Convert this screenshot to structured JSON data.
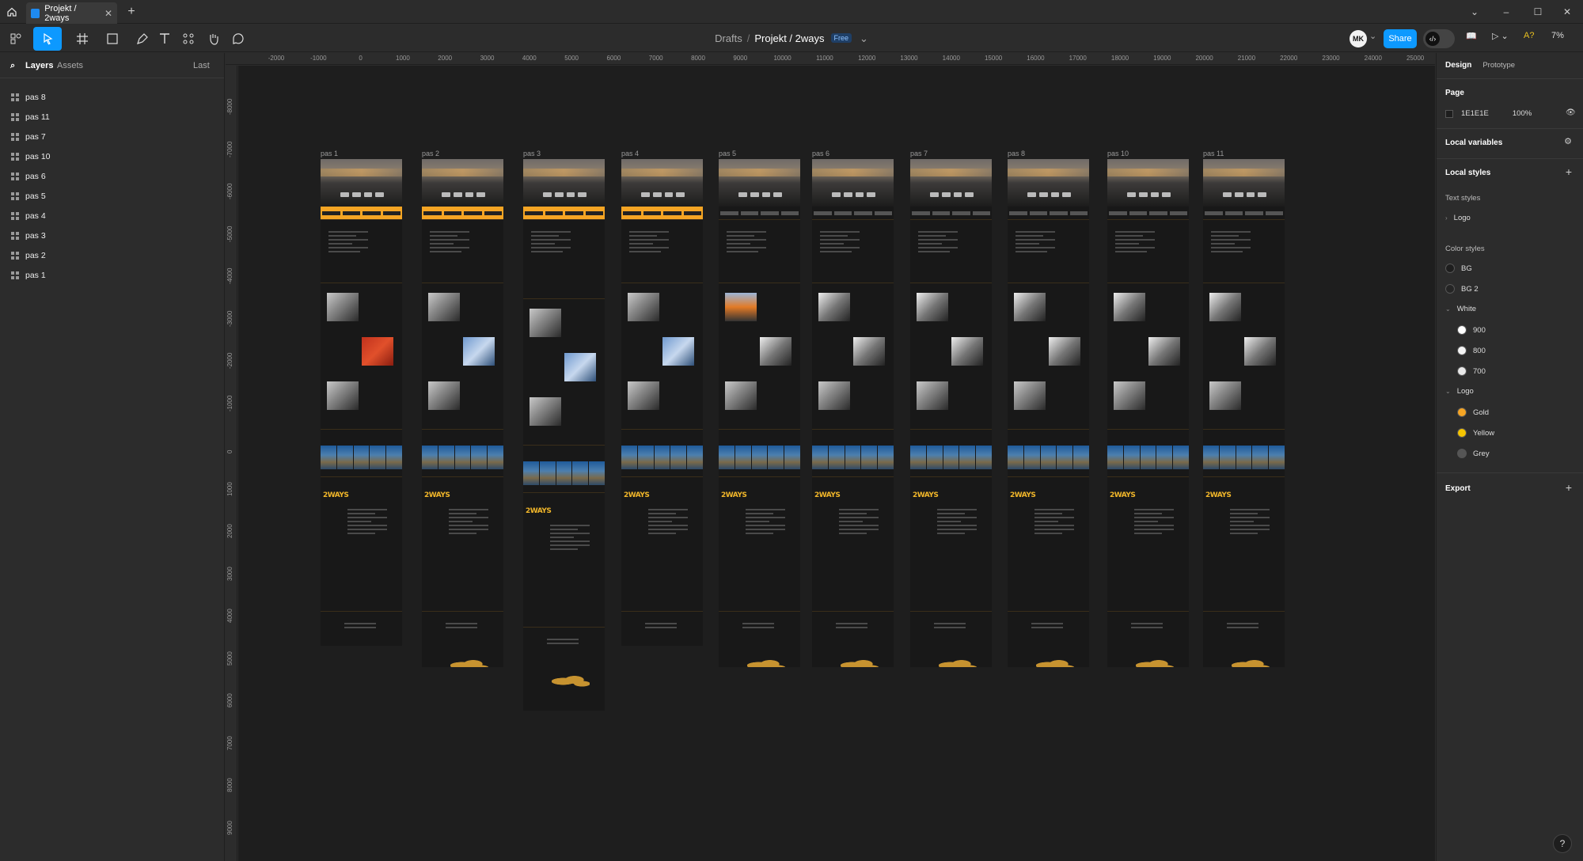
{
  "tabs": [
    {
      "label": "Projekt / 2ways"
    }
  ],
  "toolbar": {
    "breadcrumb_parent": "Drafts",
    "breadcrumb_current": "Projekt / 2ways",
    "plan_badge": "Free",
    "avatar_initials": "MK",
    "share_label": "Share",
    "zoom": "7%",
    "a11y_label": "A?"
  },
  "left_panel": {
    "tab_layers": "Layers",
    "tab_assets": "Assets",
    "sort_label": "Last",
    "layers": [
      "pas 8",
      "pas 11",
      "pas 7",
      "pas 10",
      "pas 6",
      "pas 5",
      "pas 4",
      "pas 3",
      "pas 2",
      "pas 1"
    ]
  },
  "ruler": {
    "top": [
      "-2000",
      "-1000",
      "0",
      "1000",
      "2000",
      "3000",
      "4000",
      "5000",
      "6000",
      "7000",
      "8000",
      "9000",
      "10000",
      "11000",
      "12000",
      "13000",
      "14000",
      "15000",
      "16000",
      "17000",
      "18000",
      "19000",
      "20000",
      "21000",
      "22000",
      "23000",
      "24000",
      "25000"
    ],
    "left": [
      "-8000",
      "-7000",
      "-6000",
      "-5000",
      "-4000",
      "-3000",
      "-2000",
      "-1000",
      "0",
      "1000",
      "2000",
      "3000",
      "4000",
      "5000",
      "6000",
      "7000",
      "8000",
      "9000"
    ]
  },
  "frames": [
    {
      "label": "pas 1"
    },
    {
      "label": "pas 2"
    },
    {
      "label": "pas 3"
    },
    {
      "label": "pas 4"
    },
    {
      "label": "pas 5"
    },
    {
      "label": "pas 6"
    },
    {
      "label": "pas 7"
    },
    {
      "label": "pas 8"
    },
    {
      "label": "pas 10"
    },
    {
      "label": "pas 11"
    }
  ],
  "frame_logo": "2WAYS",
  "frame_strip_text": "NIEZAWODNOŚĆ TRWAŁOŚĆ & NAJ",
  "right_panel": {
    "tab_design": "Design",
    "tab_prototype": "Prototype",
    "page_heading": "Page",
    "page_color": "1E1E1E",
    "page_opacity": "100%",
    "local_variables": "Local variables",
    "local_styles": "Local styles",
    "text_styles": "Text styles",
    "text_style_items": [
      "Logo"
    ],
    "color_styles": "Color styles",
    "colors": [
      {
        "name": "BG",
        "hex": "#1e1e1e"
      },
      {
        "name": "BG 2",
        "hex": "#252525"
      }
    ],
    "white_group": "White",
    "white_items": [
      {
        "name": "900",
        "hex": "#ffffff"
      },
      {
        "name": "800",
        "hex": "#f4f4f4"
      },
      {
        "name": "700",
        "hex": "#e8e8e8"
      }
    ],
    "logo_group": "Logo",
    "logo_items": [
      {
        "name": "Gold",
        "hex": "#f5a524"
      },
      {
        "name": "Yellow",
        "hex": "#f5c400"
      },
      {
        "name": "Grey",
        "hex": "#555555"
      }
    ],
    "export": "Export"
  },
  "help_label": "?"
}
